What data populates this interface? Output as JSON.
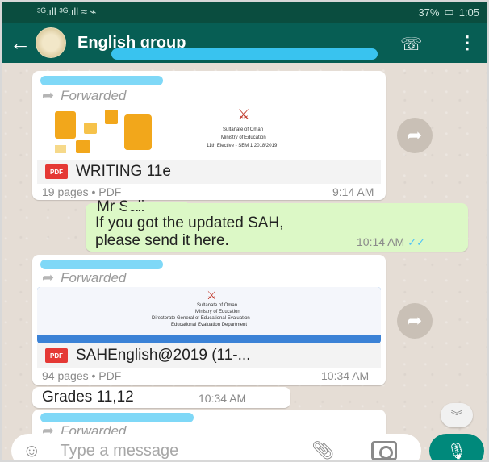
{
  "status_bar": {
    "signal": "³ᴳ.ıll ³ᴳ.ıll ≈ ⌁",
    "battery": "37%",
    "time": "1:05"
  },
  "header": {
    "title": "English group"
  },
  "messages": [
    {
      "type": "document",
      "forwarded_label": "Forwarded",
      "thumb_text": [
        "Sultanate of Oman",
        "Ministry of Education",
        "11th Elective - SEM 1 2018/2019"
      ],
      "file_name": "WRITING 11e",
      "meta": "19 pages • PDF",
      "time": "9:14 AM"
    },
    {
      "type": "text_outgoing",
      "sender": "Mr Sali",
      "lines": [
        "If you got the updated SAH,",
        "please send it here."
      ],
      "time": "10:14 AM"
    },
    {
      "type": "document",
      "forwarded_label": "Forwarded",
      "thumb_text": [
        "Sultanate of Oman",
        "Ministry of Education",
        "Directorate General of Educational Evaluation",
        "Educational Evaluation Department"
      ],
      "file_name": "SAHEnglish@2019 (11-...",
      "meta": "94 pages • PDF",
      "time": "10:34 AM"
    },
    {
      "type": "text",
      "text": "Grades 11,12",
      "time": "10:34 AM"
    },
    {
      "type": "document_partial",
      "forwarded_label": "Forwarded"
    }
  ],
  "input": {
    "placeholder": "Type a message"
  },
  "pdf_badge": "PDF",
  "icons": {
    "back": "back-arrow-icon",
    "call": "add-call-icon",
    "menu": "more-vert-icon",
    "share": "share-forward-icon",
    "emoji": "emoji-icon",
    "attach": "paperclip-icon",
    "camera": "camera-icon",
    "mic": "mic-icon"
  },
  "colors": {
    "header": "#075e54",
    "status": "#0a4d3f",
    "outgoing": "#dcf8c6",
    "accent": "#00897b"
  }
}
